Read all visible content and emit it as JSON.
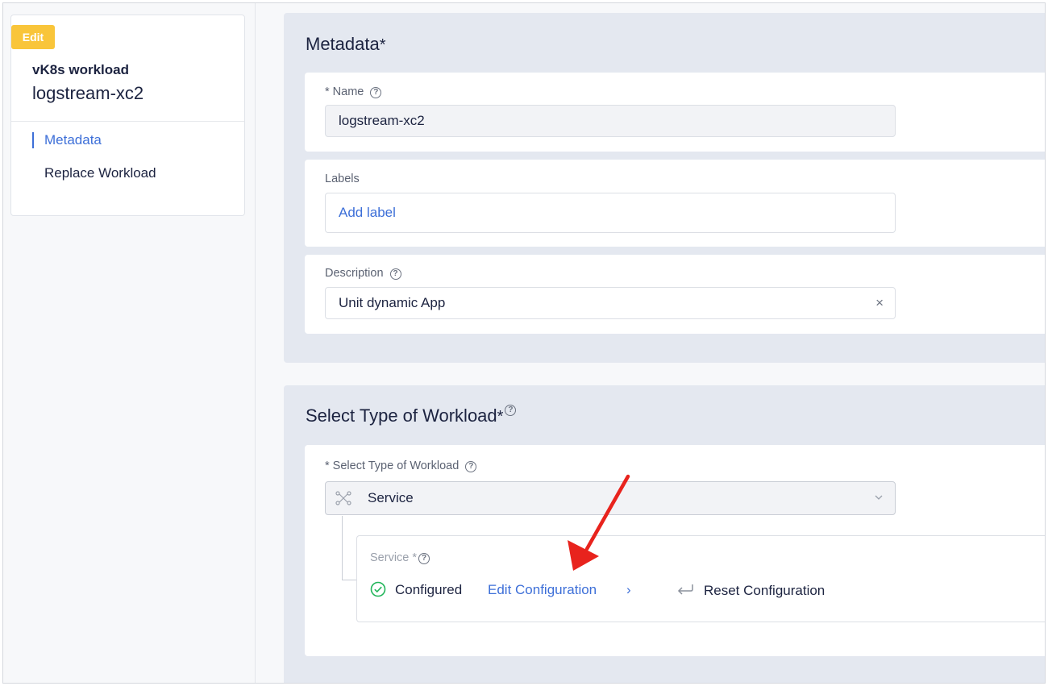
{
  "nav": {
    "badge": "Edit",
    "subtitle": "vK8s workload",
    "title": "logstream-xc2",
    "items": [
      {
        "label": "Metadata",
        "active": true
      },
      {
        "label": "Replace Workload",
        "active": false
      }
    ]
  },
  "metadata": {
    "title": "Metadata",
    "required_mark": "*",
    "name_label": "* Name",
    "name_value": "logstream-xc2",
    "labels_label": "Labels",
    "add_label": "Add label",
    "description_label": "Description",
    "description_value": "Unit dynamic App",
    "clear_glyph": "×"
  },
  "workload_type": {
    "title": "Select Type of Workload",
    "required_mark": "*",
    "field_label": "* Select Type of Workload",
    "selected": "Service",
    "service_label": "Service *",
    "status": "Configured",
    "edit_link": "Edit Configuration",
    "edit_chevron": "›",
    "reset": "Reset Configuration"
  },
  "help_glyph": "?",
  "colors": {
    "accent": "#3d6fd8",
    "badge": "#f9c53a",
    "success": "#22b55a",
    "annotation_arrow": "#e8231d"
  },
  "icons": [
    "help-icon",
    "service-topology-icon",
    "chevron-down-icon",
    "check-circle-icon",
    "reset-icon",
    "clear-icon"
  ]
}
